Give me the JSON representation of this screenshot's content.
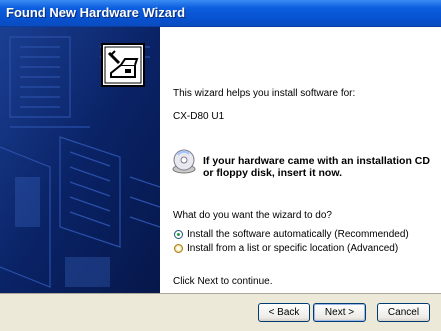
{
  "window": {
    "title": "Found New Hardware Wizard"
  },
  "body": {
    "intro": "This wizard helps you install software for:",
    "device": "CX-D80 U1",
    "cd_note_line1": "If your hardware came with an installation CD",
    "cd_note_line2": "or floppy disk, insert it now.",
    "question": "What do you want the wizard to do?",
    "options": [
      {
        "label": "Install the software automatically (Recommended)",
        "selected": true
      },
      {
        "label": "Install from a list or specific location (Advanced)",
        "selected": false
      }
    ],
    "continue_text": "Click Next to continue."
  },
  "buttons": {
    "back": "< Back",
    "next": "Next >",
    "cancel": "Cancel"
  },
  "colors": {
    "titlebar": "#0752d0",
    "sidepanel": "#0c2a6a",
    "footer": "#ece9d8"
  },
  "icons": {
    "wizard": "hardware-wizard-icon",
    "cd": "cd-icon"
  }
}
